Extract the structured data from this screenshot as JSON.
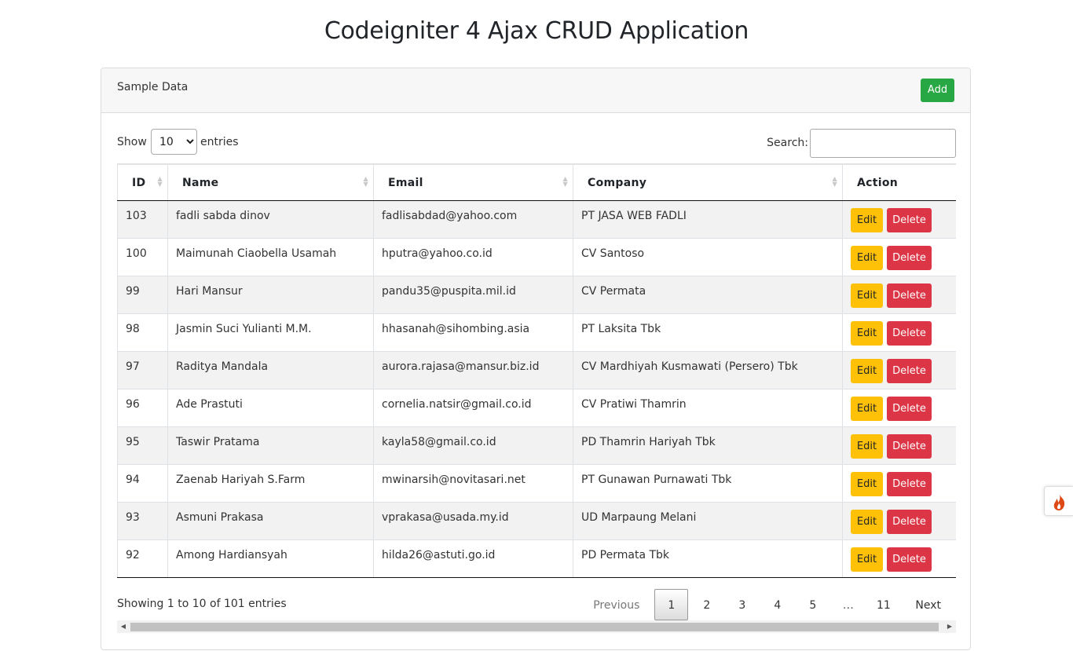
{
  "page": {
    "title": "Codeigniter 4 Ajax CRUD Application"
  },
  "card": {
    "header_title": "Sample Data",
    "add_label": "Add"
  },
  "controls": {
    "show_label": "Show",
    "entries_label": "entries",
    "length_value": "10",
    "search_label": "Search:",
    "search_value": ""
  },
  "table": {
    "columns": [
      "ID",
      "Name",
      "Email",
      "Company",
      "Action"
    ],
    "edit_label": "Edit",
    "delete_label": "Delete",
    "rows": [
      {
        "id": "103",
        "name": "fadli sabda dinov",
        "email": "fadlisabdad@yahoo.com",
        "company": "PT JASA WEB FADLI"
      },
      {
        "id": "100",
        "name": "Maimunah Ciaobella Usamah",
        "email": "hputra@yahoo.co.id",
        "company": "CV Santoso"
      },
      {
        "id": "99",
        "name": "Hari Mansur",
        "email": "pandu35@puspita.mil.id",
        "company": "CV Permata"
      },
      {
        "id": "98",
        "name": "Jasmin Suci Yulianti M.M.",
        "email": "hhasanah@sihombing.asia",
        "company": "PT Laksita Tbk"
      },
      {
        "id": "97",
        "name": "Raditya Mandala",
        "email": "aurora.rajasa@mansur.biz.id",
        "company": "CV Mardhiyah Kusmawati (Persero) Tbk"
      },
      {
        "id": "96",
        "name": "Ade Prastuti",
        "email": "cornelia.natsir@gmail.co.id",
        "company": "CV Pratiwi Thamrin"
      },
      {
        "id": "95",
        "name": "Taswir Pratama",
        "email": "kayla58@gmail.co.id",
        "company": "PD Thamrin Hariyah Tbk"
      },
      {
        "id": "94",
        "name": "Zaenab Hariyah S.Farm",
        "email": "mwinarsih@novitasari.net",
        "company": "PT Gunawan Purnawati Tbk"
      },
      {
        "id": "93",
        "name": "Asmuni Prakasa",
        "email": "vprakasa@usada.my.id",
        "company": "UD Marpaung Melani"
      },
      {
        "id": "92",
        "name": "Among Hardiansyah",
        "email": "hilda26@astuti.go.id",
        "company": "PD Permata Tbk"
      }
    ]
  },
  "footer": {
    "info": "Showing 1 to 10 of 101 entries",
    "pagination": {
      "previous": "Previous",
      "pages": [
        "1",
        "2",
        "3",
        "4",
        "5"
      ],
      "ellipsis": "…",
      "last": "11",
      "next": "Next",
      "current": "1"
    }
  },
  "colors": {
    "add": "#28a745",
    "edit": "#ffc107",
    "delete": "#dc3545",
    "ci_flame": "#dd4814"
  },
  "icons": {
    "ci_toolbar": "codeigniter-flame-icon",
    "sort": "sort-both-icon"
  }
}
